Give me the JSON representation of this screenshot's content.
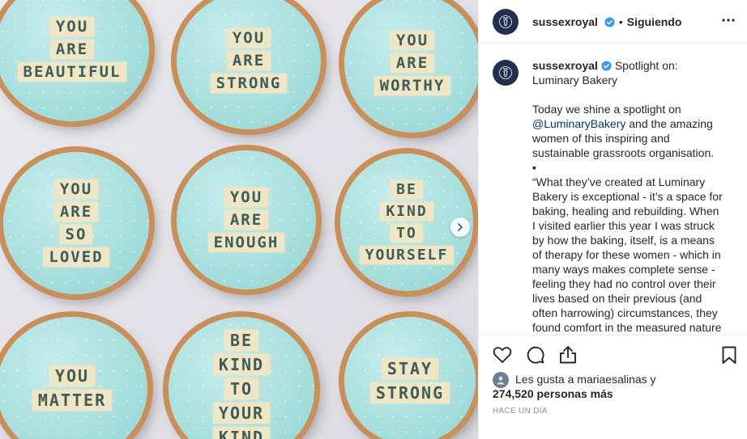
{
  "post": {
    "username": "sussexroyal",
    "follow_status": "Siguiendo",
    "separator": "•",
    "caption": {
      "lead": "Spotlight on: Luminary Bakery",
      "para1_before": "Today we shine a spotlight on ",
      "mention": "@LuminaryBakery",
      "para1_after": " and the amazing women of this inspiring and sustainable grassroots organisation.",
      "bullet": "▪",
      "para2": "“What they’ve created at Luminary Bakery is exceptional - it’s a space for baking, healing and rebuilding. When I visited earlier this year I was struck by how the baking, itself, is a means of therapy for these women - which in many ways makes complete sense - feeling they had no control over their lives based on their previous (and often harrowing) circumstances, they found comfort in the measured nature"
    },
    "likes_line1": "Les gusta a mariaesalinas y",
    "likes_line2": "274,520 personas más",
    "timestamp": "HACE UN DÍA"
  },
  "cupcakes": [
    {
      "lines": [
        "YOU",
        "ARE",
        "BEAUTIFUL"
      ]
    },
    {
      "lines": [
        "YOU",
        "ARE",
        "STRONG"
      ]
    },
    {
      "lines": [
        "YOU",
        "ARE",
        "WORTHY"
      ]
    },
    {
      "lines": [
        "YOU",
        "ARE",
        "SO",
        "LOVED"
      ]
    },
    {
      "lines": [
        "YOU",
        "ARE",
        "ENOUGH"
      ]
    },
    {
      "lines": [
        "BE",
        "KIND",
        "TO",
        "YOURSELF"
      ]
    },
    {
      "lines": [
        "YOU",
        "MATTER"
      ]
    },
    {
      "lines": [
        "BE",
        "KIND",
        "TO",
        "YOUR",
        "KIND"
      ]
    },
    {
      "lines": [
        "STAY",
        "STRONG"
      ]
    }
  ],
  "icons": {
    "more": "more-options-icon",
    "heart": "heart-icon",
    "comment": "comment-icon",
    "share": "share-icon",
    "save": "bookmark-icon",
    "next": "chevron-right-icon",
    "verified": "verified-badge-icon"
  },
  "colors": {
    "frosting": "#a9e0df",
    "lettering": "#efe6c6",
    "avatar": "#1f2f4d",
    "verified": "#3897f0",
    "mention": "#00376b"
  }
}
